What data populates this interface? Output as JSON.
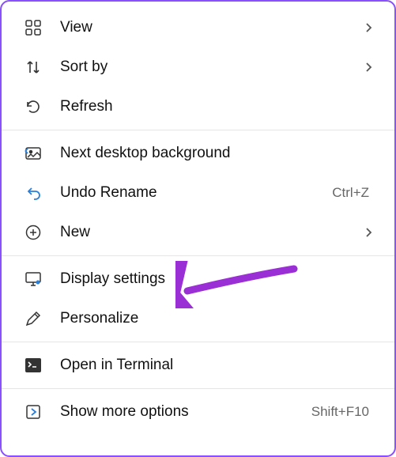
{
  "menu": {
    "items": [
      {
        "label": "View",
        "has_submenu": true
      },
      {
        "label": "Sort by",
        "has_submenu": true
      },
      {
        "label": "Refresh"
      },
      {
        "label": "Next desktop background"
      },
      {
        "label": "Undo Rename",
        "shortcut": "Ctrl+Z"
      },
      {
        "label": "New",
        "has_submenu": true
      },
      {
        "label": "Display settings"
      },
      {
        "label": "Personalize"
      },
      {
        "label": "Open in Terminal"
      },
      {
        "label": "Show more options",
        "shortcut": "Shift+F10"
      }
    ]
  },
  "annotation": {
    "color": "#9b2fd6"
  }
}
